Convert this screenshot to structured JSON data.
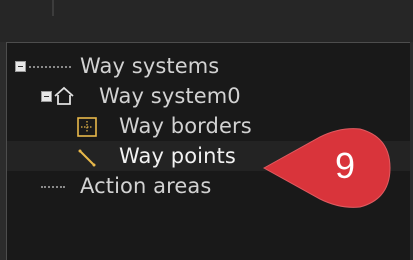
{
  "tree": {
    "items": [
      {
        "label": "Way systems",
        "icon": "expander-minus-icon",
        "connector": "dotted-line"
      },
      {
        "label": "Way system0",
        "icon": "home-icon",
        "connector": "expander-minus-icon"
      },
      {
        "label": "Way borders",
        "icon": "way-borders-icon"
      },
      {
        "label": "Way points",
        "icon": "way-points-icon",
        "selected": true
      },
      {
        "label": "Action areas",
        "icon": "dotted-line"
      }
    ]
  },
  "callout": {
    "number": "9",
    "color": "#d9343b"
  },
  "colors": {
    "background": "#191919",
    "text": "#d2d2d2",
    "icon_gold": "#e8b84a",
    "selection": "#232323"
  }
}
